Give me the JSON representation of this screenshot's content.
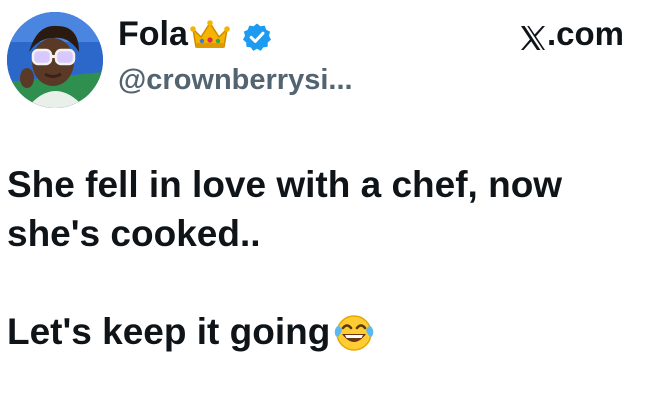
{
  "user": {
    "display_name": "Fola",
    "name_emoji": "crown-emoji",
    "verified": true,
    "verified_color": "#1d9bf0",
    "handle": "@crownberrysi..."
  },
  "site": {
    "label": ".com",
    "logo": "x-logo-icon"
  },
  "tweet": {
    "lines": [
      "She fell in love with a chef, now",
      "she's cooked..",
      "Let's keep it going"
    ],
    "trailing_emoji": "tears-of-joy-emoji"
  },
  "colors": {
    "text": "#0f1419",
    "handle": "#536471",
    "background": "#ffffff"
  }
}
